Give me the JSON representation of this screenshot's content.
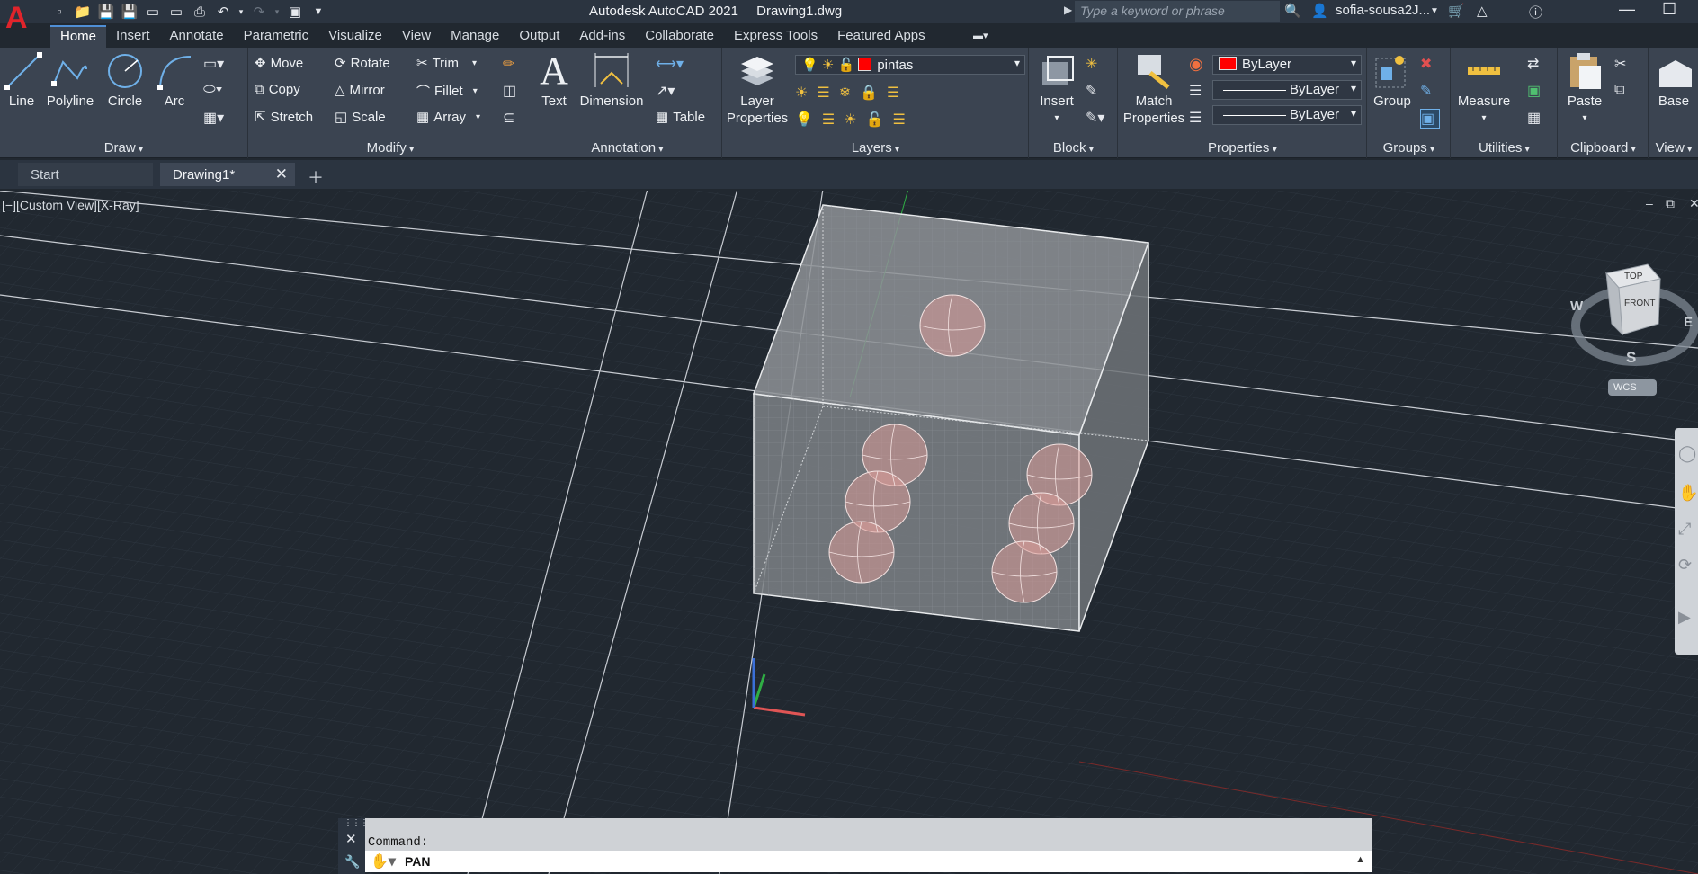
{
  "app": {
    "title": "Autodesk AutoCAD 2021",
    "document": "Drawing1.dwg"
  },
  "search": {
    "placeholder": "Type a keyword or phrase"
  },
  "user": {
    "name": "sofia-sousa2J..."
  },
  "ribbon_tabs": [
    "Home",
    "Insert",
    "Annotate",
    "Parametric",
    "Visualize",
    "View",
    "Manage",
    "Output",
    "Add-ins",
    "Collaborate",
    "Express Tools",
    "Featured Apps"
  ],
  "active_tab": "Home",
  "panels": {
    "draw": {
      "title": "Draw",
      "line": "Line",
      "polyline": "Polyline",
      "circle": "Circle",
      "arc": "Arc"
    },
    "modify": {
      "title": "Modify",
      "move": "Move",
      "rotate": "Rotate",
      "trim": "Trim",
      "copy": "Copy",
      "mirror": "Mirror",
      "fillet": "Fillet",
      "stretch": "Stretch",
      "scale": "Scale",
      "array": "Array"
    },
    "annotation": {
      "title": "Annotation",
      "text": "Text",
      "dimension": "Dimension",
      "table": "Table"
    },
    "layers": {
      "title": "Layers",
      "layer_properties_1": "Layer",
      "layer_properties_2": "Properties",
      "current_layer": "pintas",
      "current_layer_color": "#ff0000"
    },
    "block": {
      "title": "Block",
      "insert": "Insert"
    },
    "properties": {
      "title": "Properties",
      "match_1": "Match",
      "match_2": "Properties",
      "color": "ByLayer",
      "linetype": "ByLayer",
      "lineweight": "ByLayer"
    },
    "groups": {
      "title": "Groups",
      "group": "Group"
    },
    "utilities": {
      "title": "Utilities",
      "measure": "Measure"
    },
    "clipboard": {
      "title": "Clipboard",
      "paste": "Paste"
    },
    "view": {
      "title": "View",
      "base": "Base"
    }
  },
  "doc_tabs": {
    "start": "Start",
    "drawing": "Drawing1*"
  },
  "viewport": {
    "label": "[−][Custom View][X-Ray]"
  },
  "viewcube": {
    "top": "TOP",
    "front": "FRONT",
    "w": "W",
    "e": "E",
    "s": "S",
    "wcs": "WCS"
  },
  "command": {
    "history": "Command:",
    "current": "PAN"
  },
  "colors": {
    "accent": "#4f8fd6",
    "brand": "#e0242b",
    "layer_red": "#ff0000"
  }
}
